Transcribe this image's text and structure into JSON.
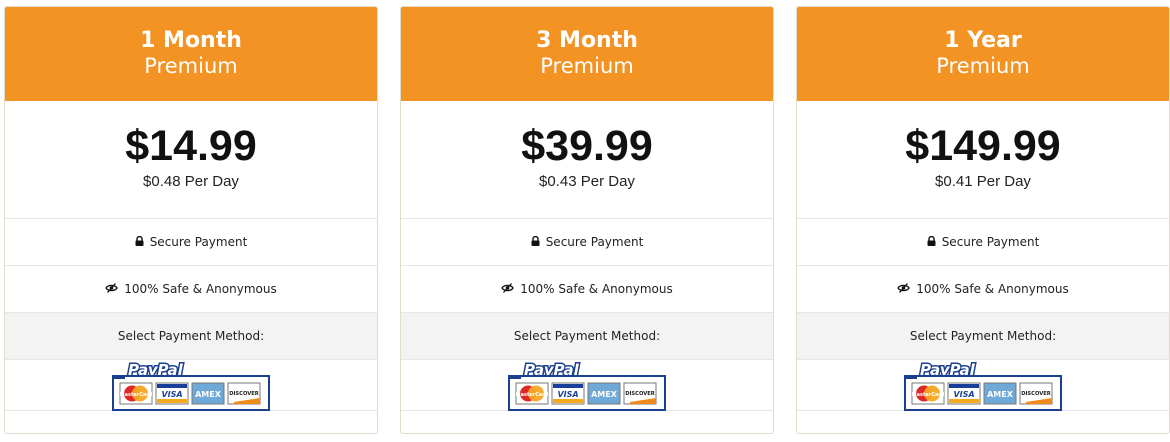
{
  "plans": [
    {
      "name": "1 Month",
      "tier": "Premium",
      "price": "$14.99",
      "per_day": "$0.48 Per Day"
    },
    {
      "name": "3 Month",
      "tier": "Premium",
      "price": "$39.99",
      "per_day": "$0.43 Per Day"
    },
    {
      "name": "1 Year",
      "tier": "Premium",
      "price": "$149.99",
      "per_day": "$0.41 Per Day"
    }
  ],
  "features": {
    "secure": "Secure Payment",
    "safe": "100% Safe & Anonymous",
    "select": "Select Payment Method:"
  },
  "payment": {
    "brand": "PayPal",
    "cards": [
      "MasterCard",
      "VISA",
      "AMEX",
      "DISCOVER"
    ]
  },
  "colors": {
    "header_bg": "#f39323",
    "paypal_blue": "#1b3f8f"
  }
}
